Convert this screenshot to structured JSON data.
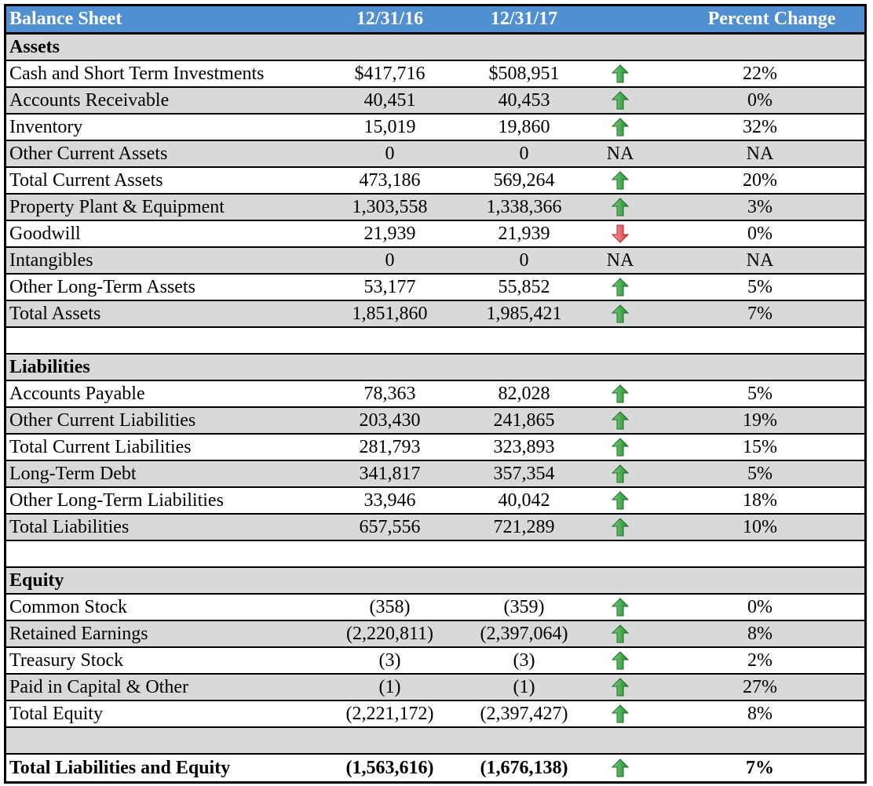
{
  "header": {
    "title": "Balance Sheet",
    "col1": "12/31/16",
    "col2": "12/31/17",
    "col3": "",
    "col4": "Percent Change"
  },
  "colors": {
    "header_bg": "#4f8fd2",
    "row_grey": "#d9d9d9",
    "up_arrow": "#2e9e3e",
    "down_arrow": "#e0474c"
  },
  "rows": [
    {
      "type": "section",
      "label": "Assets",
      "bg": "grey"
    },
    {
      "type": "data",
      "label": "Cash and Short Term Investments",
      "v1": "$417,716",
      "v2": "$508,951",
      "trend": "up",
      "pct": "22%",
      "bg": "white"
    },
    {
      "type": "data",
      "label": "Accounts Receivable",
      "v1": "40,451",
      "v2": "40,453",
      "trend": "up",
      "pct": "0%",
      "bg": "grey"
    },
    {
      "type": "data",
      "label": "Inventory",
      "v1": "15,019",
      "v2": "19,860",
      "trend": "up",
      "pct": "32%",
      "bg": "white"
    },
    {
      "type": "data",
      "label": "Other Current Assets",
      "v1": "0",
      "v2": "0",
      "trend": "NA",
      "pct": "NA",
      "bg": "grey"
    },
    {
      "type": "data",
      "label": "Total Current Assets",
      "v1": "473,186",
      "v2": "569,264",
      "trend": "up",
      "pct": "20%",
      "bg": "white"
    },
    {
      "type": "data",
      "label": "Property Plant & Equipment",
      "v1": "1,303,558",
      "v2": "1,338,366",
      "trend": "up",
      "pct": "3%",
      "bg": "grey"
    },
    {
      "type": "data",
      "label": "Goodwill",
      "v1": "21,939",
      "v2": "21,939",
      "trend": "down",
      "pct": "0%",
      "bg": "white"
    },
    {
      "type": "data",
      "label": "Intangibles",
      "v1": "0",
      "v2": "0",
      "trend": "NA",
      "pct": "NA",
      "bg": "grey"
    },
    {
      "type": "data",
      "label": "Other Long-Term Assets",
      "v1": "53,177",
      "v2": "55,852",
      "trend": "up",
      "pct": "5%",
      "bg": "white"
    },
    {
      "type": "data",
      "label": "Total Assets",
      "v1": "1,851,860",
      "v2": "1,985,421",
      "trend": "up",
      "pct": "7%",
      "bg": "grey"
    },
    {
      "type": "blank",
      "bg": "white"
    },
    {
      "type": "section",
      "label": "Liabilities",
      "bg": "grey"
    },
    {
      "type": "data",
      "label": "Accounts Payable",
      "v1": "78,363",
      "v2": "82,028",
      "trend": "up",
      "pct": "5%",
      "bg": "white"
    },
    {
      "type": "data",
      "label": "Other Current Liabilities",
      "v1": "203,430",
      "v2": "241,865",
      "trend": "up",
      "pct": "19%",
      "bg": "grey"
    },
    {
      "type": "data",
      "label": "Total Current Liabilities",
      "v1": "281,793",
      "v2": "323,893",
      "trend": "up",
      "pct": "15%",
      "bg": "white"
    },
    {
      "type": "data",
      "label": "Long-Term Debt",
      "v1": "341,817",
      "v2": "357,354",
      "trend": "up",
      "pct": "5%",
      "bg": "grey"
    },
    {
      "type": "data",
      "label": "Other Long-Term Liabilities",
      "v1": "33,946",
      "v2": "40,042",
      "trend": "up",
      "pct": "18%",
      "bg": "white"
    },
    {
      "type": "data",
      "label": "Total Liabilities",
      "v1": "657,556",
      "v2": "721,289",
      "trend": "up",
      "pct": "10%",
      "bg": "grey"
    },
    {
      "type": "blank",
      "bg": "white"
    },
    {
      "type": "section",
      "label": "Equity",
      "bg": "grey"
    },
    {
      "type": "data",
      "label": "Common Stock",
      "v1": "(358)",
      "v2": "(359)",
      "trend": "up",
      "pct": "0%",
      "bg": "white"
    },
    {
      "type": "data",
      "label": "Retained Earnings",
      "v1": "(2,220,811)",
      "v2": "(2,397,064)",
      "trend": "up",
      "pct": "8%",
      "bg": "grey"
    },
    {
      "type": "data",
      "label": "Treasury Stock",
      "v1": "(3)",
      "v2": "(3)",
      "trend": "up",
      "pct": "2%",
      "bg": "white"
    },
    {
      "type": "data",
      "label": "Paid in Capital & Other",
      "v1": "(1)",
      "v2": "(1)",
      "trend": "up",
      "pct": "27%",
      "bg": "grey"
    },
    {
      "type": "data",
      "label": "Total Equity",
      "v1": "(2,221,172)",
      "v2": "(2,397,427)",
      "trend": "up",
      "pct": "8%",
      "bg": "white"
    },
    {
      "type": "blank",
      "bg": "grey"
    },
    {
      "type": "data",
      "label": "Total Liabilities and Equity",
      "v1": "(1,563,616)",
      "v2": "(1,676,138)",
      "trend": "up",
      "pct": "7%",
      "bg": "white",
      "bold": true
    }
  ]
}
